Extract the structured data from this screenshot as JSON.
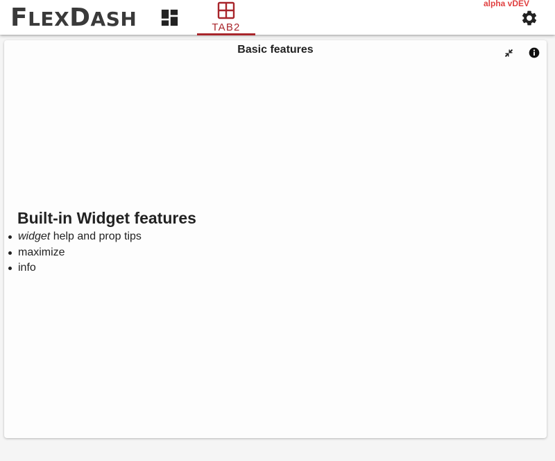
{
  "app": {
    "brand": {
      "first_big": "F",
      "first_rest": "LEX",
      "second_big": "D",
      "second_rest": "ASH"
    },
    "version": "alpha vDEV",
    "dashboard_icon": "dashboard-grid-icon",
    "settings_icon": "gear-icon"
  },
  "tabs": [
    {
      "label": "TAB2",
      "icon": "grid-icon",
      "active": true
    }
  ],
  "widget": {
    "title": "Basic features",
    "shrink_icon": "fullscreen-exit-icon",
    "info_icon": "info-icon",
    "heading": "Built-in Widget features",
    "items": [
      {
        "emphasis": "widget",
        "text": " help and prop tips"
      },
      {
        "emphasis": "",
        "text": "maximize"
      },
      {
        "emphasis": "",
        "text": "info"
      }
    ]
  },
  "colors": {
    "accent": "#a8252b",
    "version": "#e04040",
    "brand_text": "#3a3a3a",
    "background": "#f5f5f5"
  }
}
